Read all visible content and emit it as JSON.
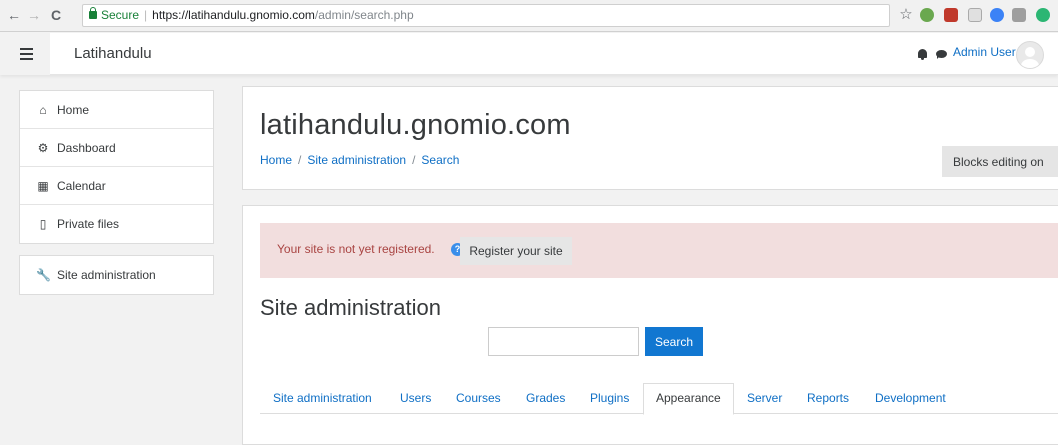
{
  "browser": {
    "back_icon": "←",
    "forward_icon": "→",
    "reload_icon": "C",
    "secure_label": "Secure",
    "url_scheme_host": "https://latihandulu.gnomio.com",
    "url_path": "/admin/search.php",
    "star_icon": "☆"
  },
  "navbar": {
    "brand": "Latihandulu",
    "user_name": "Admin User"
  },
  "nav_drawer": {
    "items": [
      {
        "label": "Home",
        "icon": "home-icon",
        "glyph": "⌂"
      },
      {
        "label": "Dashboard",
        "icon": "dashboard-icon",
        "glyph": "⚙"
      },
      {
        "label": "Calendar",
        "icon": "calendar-icon",
        "glyph": "▦"
      },
      {
        "label": "Private files",
        "icon": "file-icon",
        "glyph": "▯"
      }
    ],
    "admin_item": {
      "label": "Site administration",
      "icon": "wrench-icon",
      "glyph": "🔧"
    }
  },
  "header": {
    "site_name": "latihandulu.gnomio.com",
    "breadcrumb": [
      "Home",
      "Site administration",
      "Search"
    ],
    "breadcrumb_separator": "/",
    "blocks_editing_label": "Blocks editing on"
  },
  "main": {
    "alert_text": "Your site is not yet registered.",
    "help_glyph": "?",
    "register_button": "Register your site",
    "section_title": "Site administration",
    "search_value": "",
    "search_button": "Search",
    "tabs": [
      {
        "label": "Site administration",
        "active": false
      },
      {
        "label": "Users",
        "active": false
      },
      {
        "label": "Courses",
        "active": false
      },
      {
        "label": "Grades",
        "active": false
      },
      {
        "label": "Plugins",
        "active": false
      },
      {
        "label": "Appearance",
        "active": true
      },
      {
        "label": "Server",
        "active": false
      },
      {
        "label": "Reports",
        "active": false
      },
      {
        "label": "Development",
        "active": false
      }
    ]
  },
  "colors": {
    "link": "#0f6fc5",
    "alert_bg": "#f2dede",
    "primary_button": "#1177d1"
  }
}
